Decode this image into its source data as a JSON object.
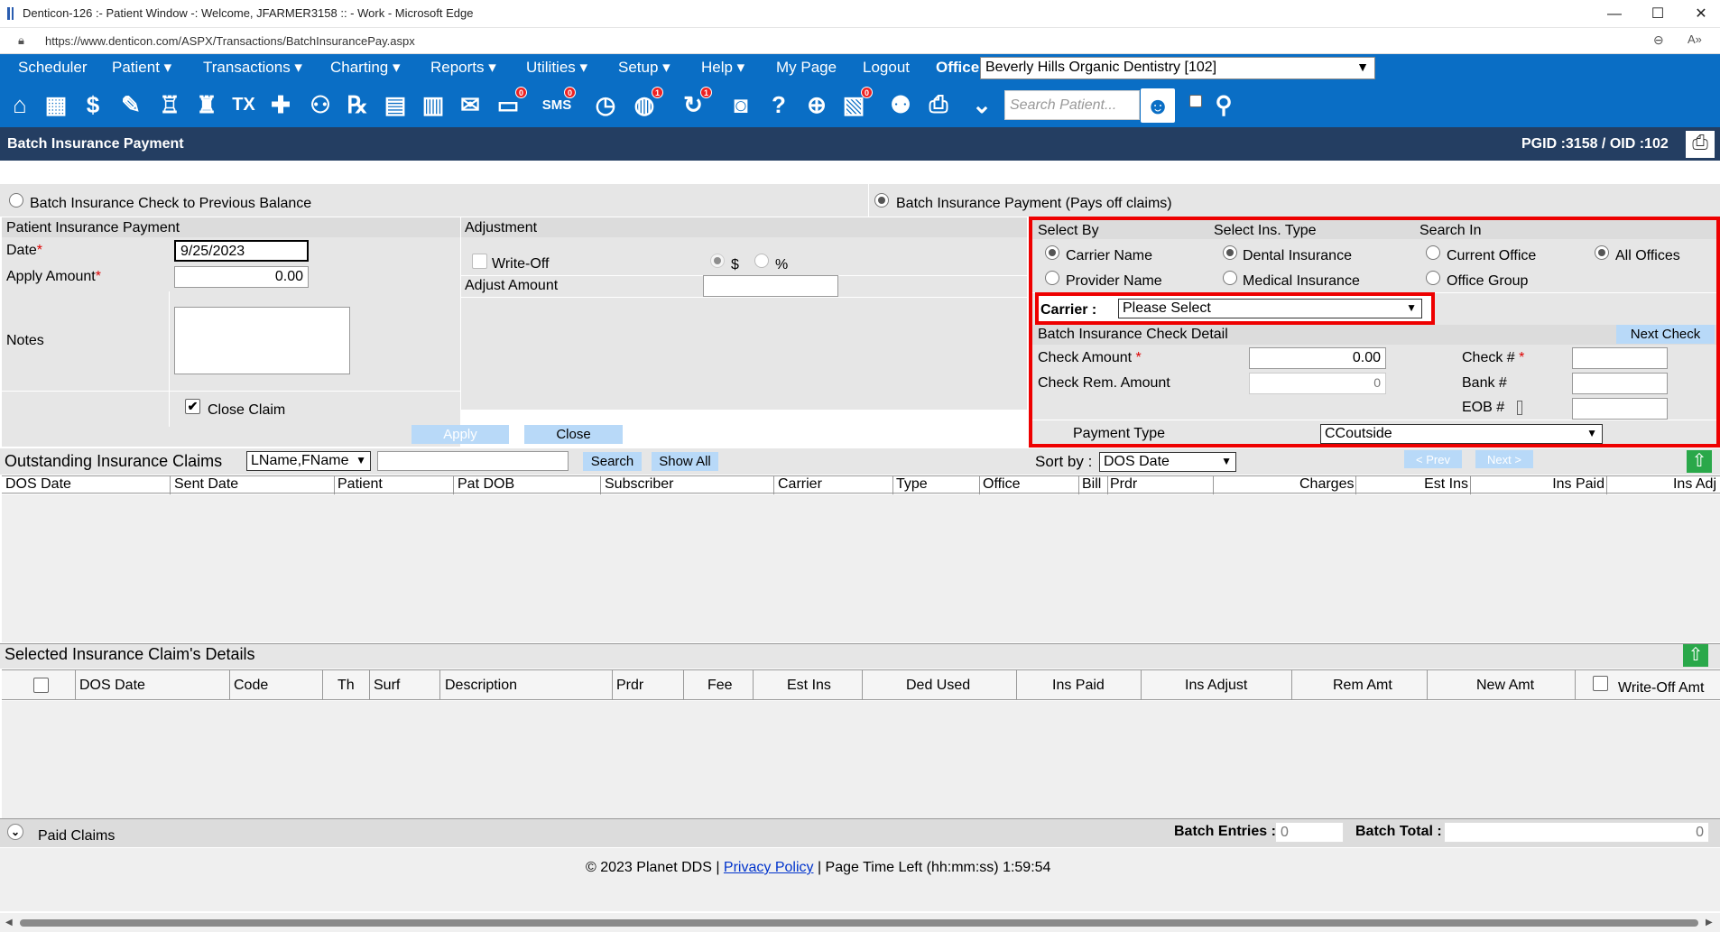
{
  "window": {
    "title": "Denticon-126 :- Patient Window -: Welcome, JFARMER3158 :: - Work - Microsoft Edge",
    "url": "https://www.denticon.com/ASPX/Transactions/BatchInsurancePay.aspx"
  },
  "nav": {
    "items": [
      "Scheduler",
      "Patient ▾",
      "Transactions ▾",
      "Charting ▾",
      "Reports ▾",
      "Utilities ▾",
      "Setup ▾",
      "Help ▾",
      "My Page",
      "Logout"
    ],
    "office_label": "Office",
    "office_value": "Beverly Hills Organic Dentistry [102]"
  },
  "toolbar": {
    "search_placeholder": "Search Patient...",
    "sms_label": "SMS",
    "badges": {
      "sms": "0",
      "globe": "1",
      "refresh": "1",
      "form": "0"
    }
  },
  "page": {
    "title": "Batch Insurance Payment",
    "pgid": "PGID :3158  /  OID :102"
  },
  "mode": {
    "option1": "Batch Insurance Check to Previous Balance",
    "option2": "Batch Insurance Payment (Pays off claims)"
  },
  "patient_payment": {
    "section": "Patient Insurance Payment",
    "date_label": "Date",
    "date_value": "9/25/2023",
    "apply_label": "Apply Amount",
    "apply_value": "0.00",
    "notes_label": "Notes",
    "close_claim": "Close Claim",
    "apply_btn": "Apply",
    "close_btn": "Close"
  },
  "adjustment": {
    "section": "Adjustment",
    "writeoff": "Write-Off",
    "dollar": "$",
    "percent": "%",
    "adjust_amount": "Adjust Amount"
  },
  "select_by": {
    "h1": "Select By",
    "h2": "Select Ins. Type",
    "h3": "Search In",
    "carrier_name": "Carrier Name",
    "provider_name": "Provider Name",
    "dental": "Dental Insurance",
    "medical": "Medical Insurance",
    "current_office": "Current Office",
    "office_group": "Office Group",
    "all_offices": "All Offices",
    "carrier_label": "Carrier :",
    "carrier_value": "Please Select"
  },
  "check_detail": {
    "section": "Batch Insurance Check Detail",
    "next_check": "Next Check",
    "check_amount": "Check Amount",
    "check_amount_value": "0.00",
    "check_rem": "Check Rem. Amount",
    "check_rem_value": "0",
    "check_no": "Check #",
    "bank_no": "Bank #",
    "eob_no": "EOB #",
    "payment_type": "Payment Type",
    "payment_type_value": "CCoutside"
  },
  "outstanding": {
    "title": "Outstanding Insurance Claims",
    "name_format": "LName,FName",
    "search_btn": "Search",
    "showall_btn": "Show All",
    "sortby_label": "Sort by :",
    "sortby_value": "DOS Date",
    "prev": "< Prev",
    "next": "Next >",
    "columns": [
      "DOS Date",
      "Sent Date",
      "Patient",
      "Pat DOB",
      "Subscriber",
      "Carrier",
      "Type",
      "Office",
      "Bill",
      "Prdr",
      "Charges",
      "Est Ins",
      "Ins Paid",
      "Ins Adj"
    ]
  },
  "selected": {
    "title": "Selected Insurance Claim's Details",
    "columns": [
      "DOS Date",
      "Code",
      "Th",
      "Surf",
      "Description",
      "Prdr",
      "Fee",
      "Est Ins",
      "Ded Used",
      "Ins Paid",
      "Ins Adjust",
      "Rem Amt",
      "New Amt",
      "Write-Off Amt"
    ]
  },
  "paid": {
    "title": "Paid Claims",
    "batch_entries_label": "Batch Entries :",
    "batch_entries_value": "0",
    "batch_total_label": "Batch Total :",
    "batch_total_value": "0"
  },
  "footer": {
    "copyright": "© 2023 Planet DDS |",
    "privacy": "Privacy Policy",
    "time_left": "|  Page Time Left (hh:mm:ss) 1:59:54"
  }
}
